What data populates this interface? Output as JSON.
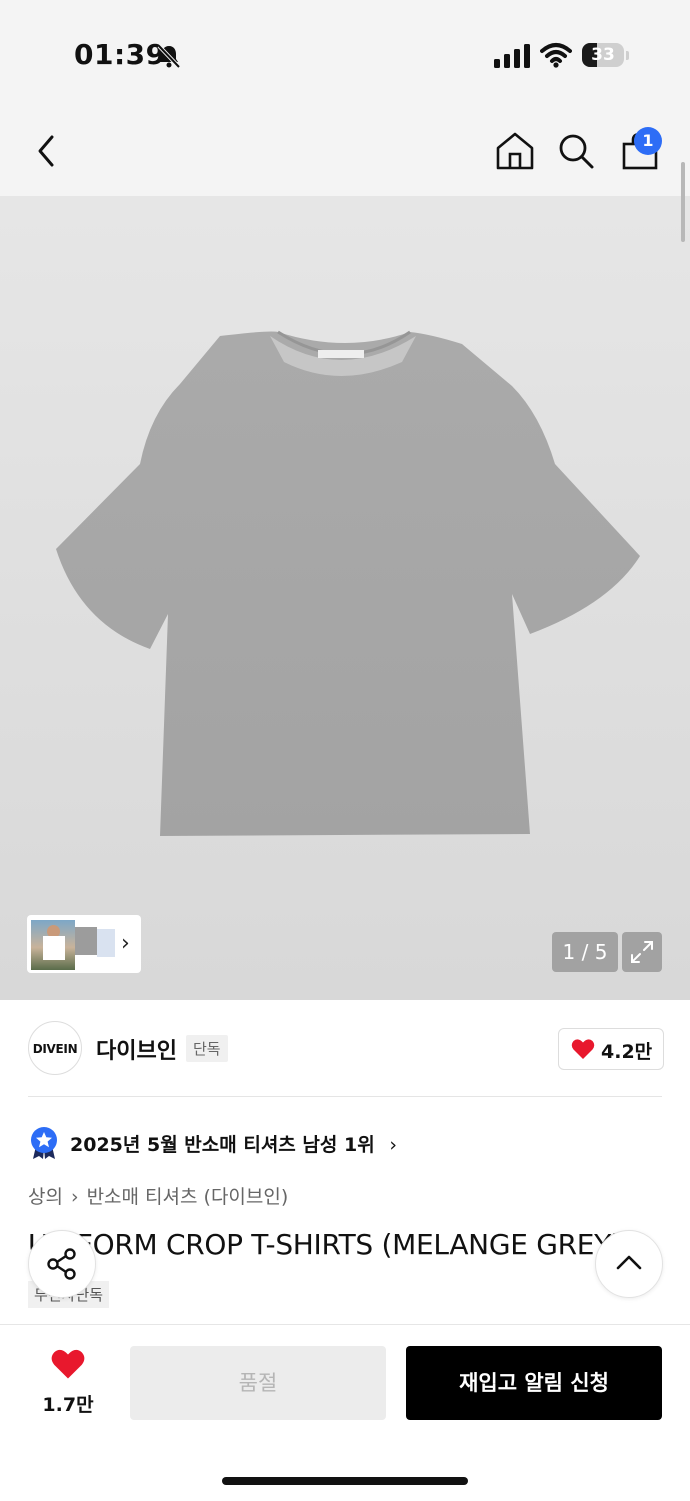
{
  "status_bar": {
    "time": "01:39",
    "battery": "33"
  },
  "header": {
    "cart_count": "1"
  },
  "gallery": {
    "pager": "1 / 5"
  },
  "brand": {
    "logo_text": "DIVEIN",
    "name": "다이브인",
    "tag": "단독",
    "likes": "4.2만"
  },
  "ranking": {
    "text": "2025년 5월 반소매 티셔츠 남성 1위",
    "chevron": "›"
  },
  "breadcrumb": {
    "level1": "상의",
    "separator": "›",
    "level2": "반소매 티셔츠 (다이브인)"
  },
  "product": {
    "title": "UNIFORM CROP T-SHIRTS (MELANGE GREY)",
    "tag": "무신사단독"
  },
  "bottom_bar": {
    "likes": "1.7만",
    "soldout_label": "품절",
    "restock_label": "재입고 알림 신청"
  },
  "colors": {
    "accent_blue": "#2d6df6",
    "heart_red": "#e8182d",
    "black": "#000000"
  }
}
